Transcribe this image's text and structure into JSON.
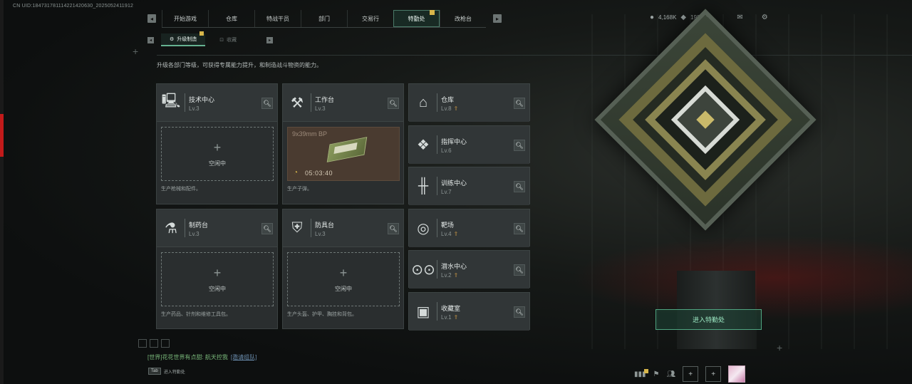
{
  "uid_text": "CN UID:184731781114221420630_2025052411912",
  "nav": {
    "tabs": [
      {
        "label": "开始游戏"
      },
      {
        "label": "仓库"
      },
      {
        "label": "特战干员"
      },
      {
        "label": "部门"
      },
      {
        "label": "交易行"
      },
      {
        "label": "特勤处",
        "active": true,
        "badge": true
      },
      {
        "label": "改枪台"
      }
    ],
    "left_arrow": "◂",
    "right_arrow": "▸"
  },
  "subnav": {
    "items": [
      {
        "label": "升级制造",
        "active": true,
        "badge": true
      },
      {
        "label": "收藏",
        "active": false
      }
    ]
  },
  "currency": {
    "coins": "4,168K",
    "tickets": "198"
  },
  "description": "升级各部门等级，可获得专属能力提升，和制造战斗物资的能力。",
  "cards": {
    "tech": {
      "name": "技术中心",
      "level": "Lv.3",
      "slot_status": "空闲中",
      "footer": "生产枪械和配件。",
      "icon": "monitor-icon"
    },
    "workbench": {
      "name": "工作台",
      "level": "Lv.3",
      "craft_item": "9x39mm BP",
      "timer": "05:03:40",
      "footer": "生产子弹。",
      "icon": "tools-icon"
    },
    "pharmacy": {
      "name": "制药台",
      "level": "Lv.3",
      "slot_status": "空闲中",
      "footer": "生产药品、针剂和维修工具包。",
      "icon": "microscope-icon"
    },
    "armor": {
      "name": "防具台",
      "level": "Lv.3",
      "slot_status": "空闲中",
      "footer": "生产头盔、护甲、胸挂和背包。",
      "icon": "armor-icon"
    }
  },
  "side_facilities": [
    {
      "name": "仓库",
      "level": "Lv.8",
      "upgradable": true,
      "icon": "warehouse-icon"
    },
    {
      "name": "指挥中心",
      "level": "Lv.6",
      "upgradable": false,
      "icon": "command-icon"
    },
    {
      "name": "训练中心",
      "level": "Lv.7",
      "upgradable": false,
      "icon": "dumbbell-icon"
    },
    {
      "name": "靶场",
      "level": "Lv.4",
      "upgradable": true,
      "icon": "target-icon"
    },
    {
      "name": "潜水中心",
      "level": "Lv.2",
      "upgradable": true,
      "icon": "diving-mask-icon"
    },
    {
      "name": "收藏室",
      "level": "Lv.1",
      "upgradable": true,
      "icon": "collection-icon"
    }
  ],
  "enter_button": "进入特勤处",
  "chat": {
    "channel": "[世界]",
    "message": "花花世界有点甜: 航天控我",
    "link": "[邀请组队]"
  },
  "tab_hint": {
    "key": "Tab",
    "label": "进入特勤处"
  },
  "colors": {
    "accent_green": "#4fa581",
    "badge_yellow": "#d8b64a",
    "upgrade_orange": "#b58a43"
  }
}
